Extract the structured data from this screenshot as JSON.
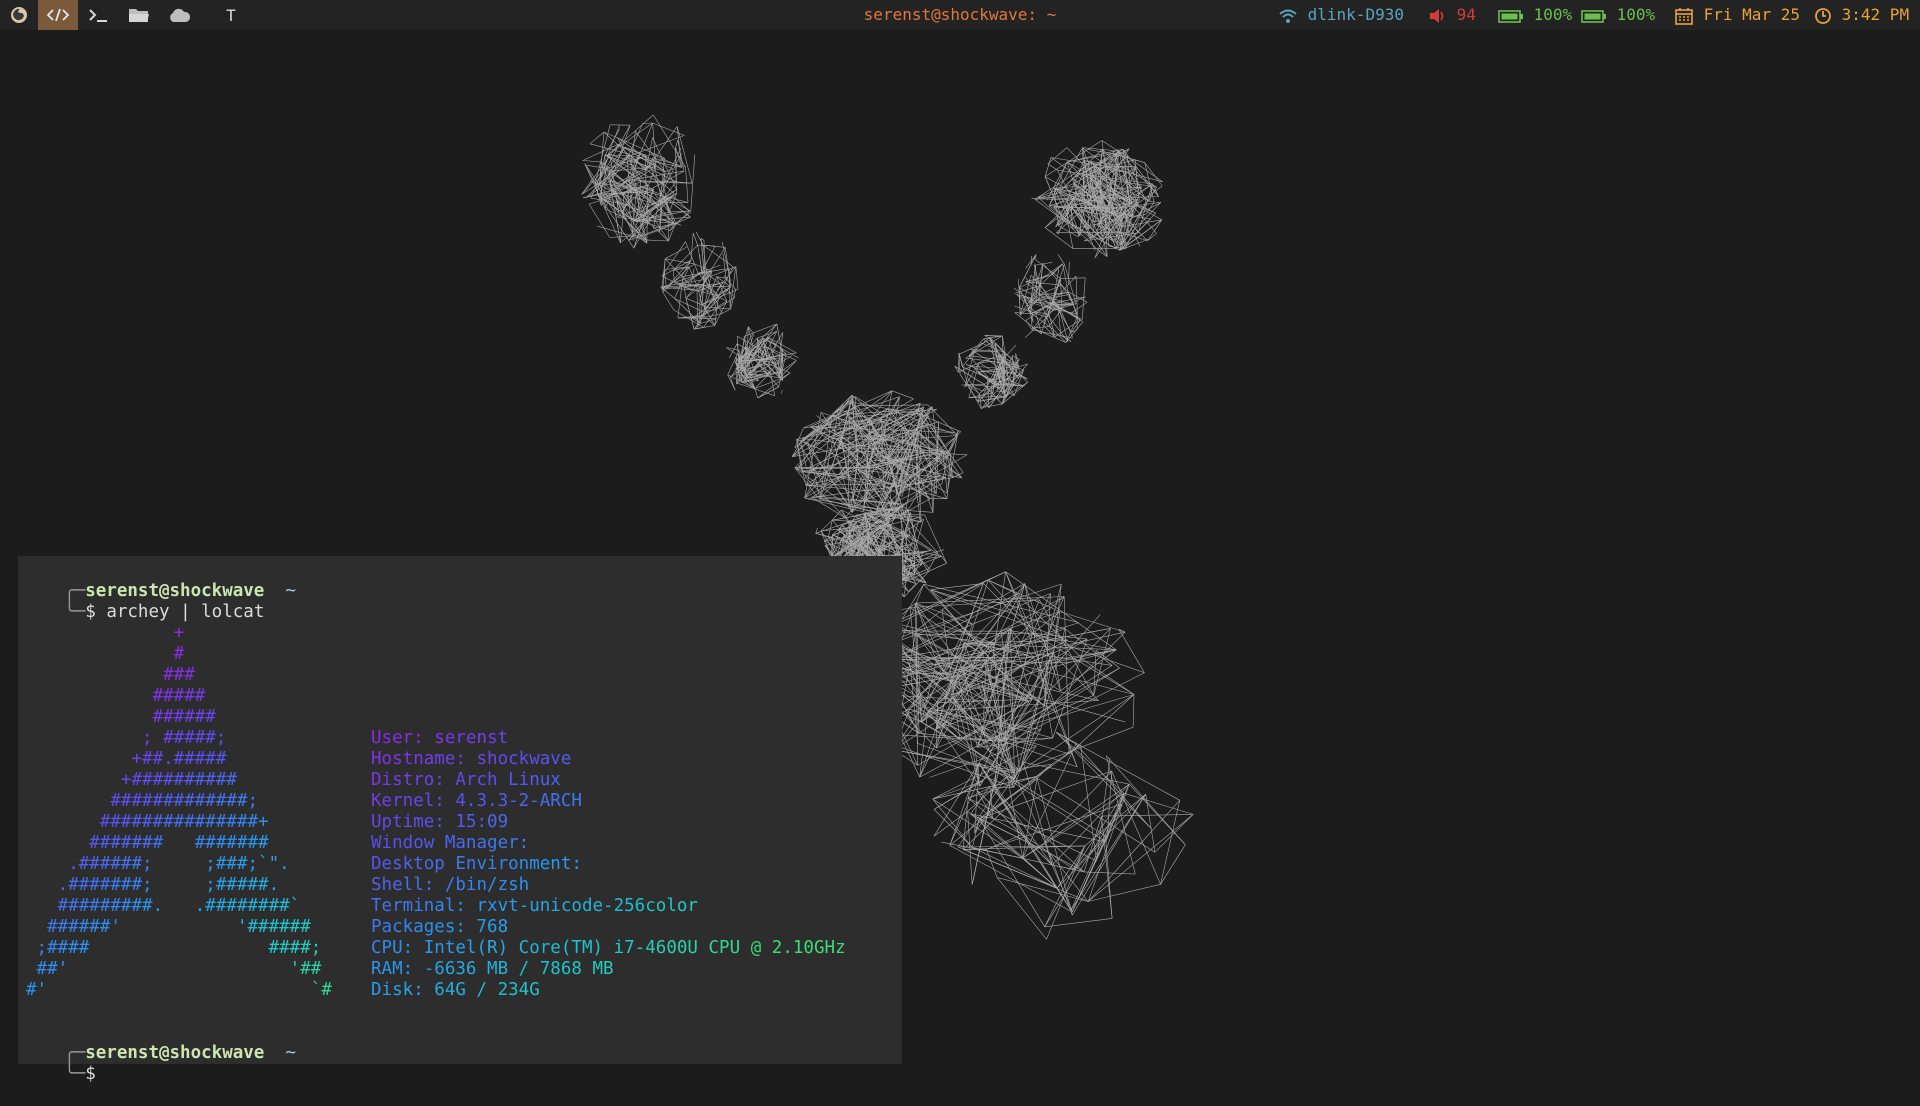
{
  "topbar": {
    "launcher_icons": [
      "firefox-icon",
      "code-icon",
      "terminal-icon",
      "folder-icon",
      "cloud-icon",
      "text-icon"
    ],
    "text_launcher": "T",
    "window_title": "serenst@shockwave: ~",
    "wifi": "dlink-D930",
    "volume": "94",
    "battery1": "100%",
    "battery2": "100%",
    "date": "Fri Mar 25",
    "time": "3:42 PM",
    "colors": {
      "accent": "#e0773c",
      "wifi": "#5aa6b8",
      "volume": "#d63b3b",
      "battery": "#6bbf4e",
      "clock": "#e8a23c"
    }
  },
  "terminal": {
    "prompt1_user": "serenst@shockwave",
    "prompt1_dir": "~",
    "prompt1_symbol": "$",
    "prompt1_cmd": "archey | lolcat",
    "art": [
      "              +",
      "              #",
      "             ###",
      "            #####",
      "            ######",
      "           ; #####;",
      "          +##.#####",
      "         +##########",
      "        #############;",
      "       ###############+",
      "      #######   #######",
      "    .######;     ;###;`\".",
      "   .#######;     ;#####.",
      "   #########.   .########`",
      "  ######'           '######",
      " ;####                 ####;",
      " ##'                     '##",
      "#'                         `#"
    ],
    "info": [
      {
        "key": "User:",
        "value": "serenst"
      },
      {
        "key": "Hostname:",
        "value": "shockwave"
      },
      {
        "key": "Distro:",
        "value": "Arch Linux"
      },
      {
        "key": "Kernel:",
        "value": "4.3.3-2-ARCH"
      },
      {
        "key": "Uptime:",
        "value": "15:09"
      },
      {
        "key": "Window Manager:",
        "value": ""
      },
      {
        "key": "Desktop Environment:",
        "value": ""
      },
      {
        "key": "Shell:",
        "value": "/bin/zsh"
      },
      {
        "key": "Terminal:",
        "value": "rxvt-unicode-256color"
      },
      {
        "key": "Packages:",
        "value": "768"
      },
      {
        "key": "CPU:",
        "value": "Intel(R) Core(TM) i7-4600U CPU @ 2.10GHz"
      },
      {
        "key": "RAM:",
        "value": "-6636 MB / 7868 MB"
      },
      {
        "key": "Disk:",
        "value": "64G / 234G"
      }
    ],
    "prompt2_user": "serenst@shockwave",
    "prompt2_dir": "~",
    "prompt2_symbol": "$"
  }
}
